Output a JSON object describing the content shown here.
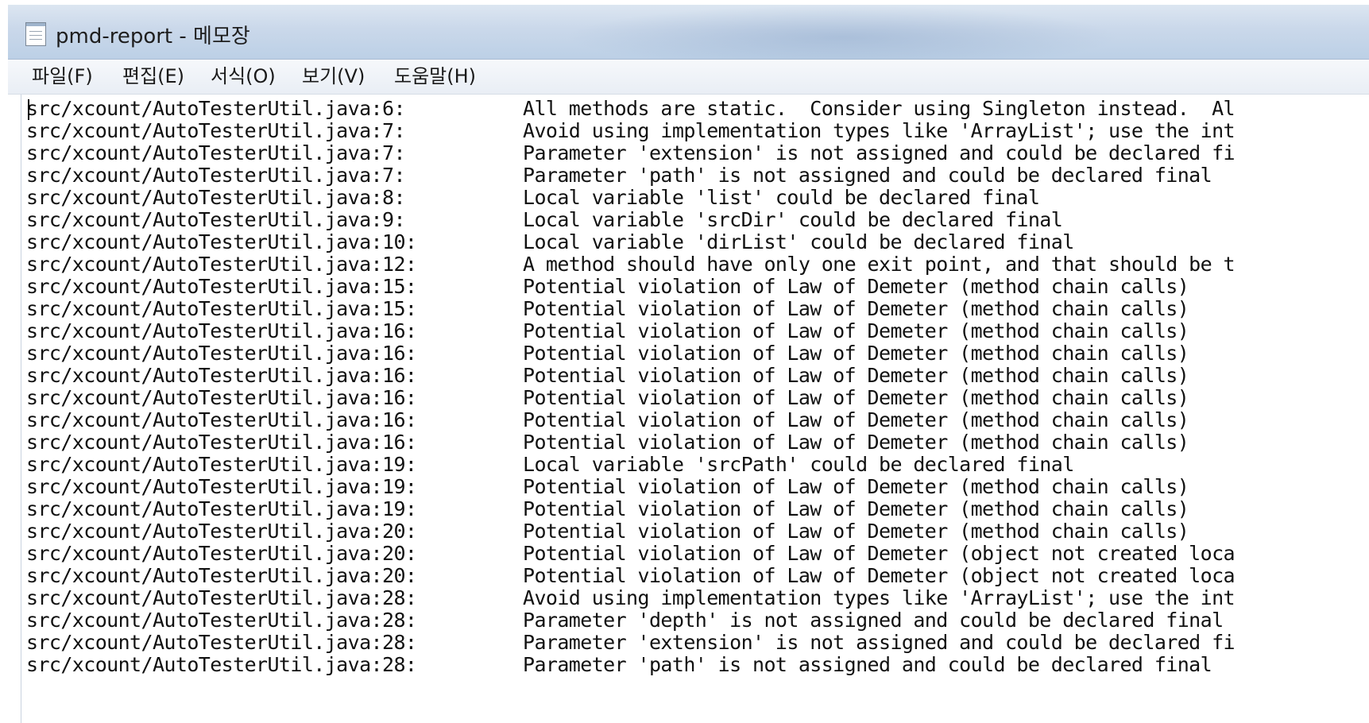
{
  "window": {
    "title": "pmd-report - 메모장"
  },
  "menu": [
    "파일(F)",
    "편집(E)",
    "서식(O)",
    "보기(V)",
    "도움말(H)"
  ],
  "lines": [
    {
      "path": "src/xcount/AutoTesterUtil.java:6:",
      "msg": "All methods are static.  Consider using Singleton instead.  Al"
    },
    {
      "path": "src/xcount/AutoTesterUtil.java:7:",
      "msg": "Avoid using implementation types like 'ArrayList'; use the int"
    },
    {
      "path": "src/xcount/AutoTesterUtil.java:7:",
      "msg": "Parameter 'extension' is not assigned and could be declared fi"
    },
    {
      "path": "src/xcount/AutoTesterUtil.java:7:",
      "msg": "Parameter 'path' is not assigned and could be declared final"
    },
    {
      "path": "src/xcount/AutoTesterUtil.java:8:",
      "msg": "Local variable 'list' could be declared final"
    },
    {
      "path": "src/xcount/AutoTesterUtil.java:9:",
      "msg": "Local variable 'srcDir' could be declared final"
    },
    {
      "path": "src/xcount/AutoTesterUtil.java:10:",
      "msg": "Local variable 'dirList' could be declared final"
    },
    {
      "path": "src/xcount/AutoTesterUtil.java:12:",
      "msg": "A method should have only one exit point, and that should be t"
    },
    {
      "path": "src/xcount/AutoTesterUtil.java:15:",
      "msg": "Potential violation of Law of Demeter (method chain calls)"
    },
    {
      "path": "src/xcount/AutoTesterUtil.java:15:",
      "msg": "Potential violation of Law of Demeter (method chain calls)"
    },
    {
      "path": "src/xcount/AutoTesterUtil.java:16:",
      "msg": "Potential violation of Law of Demeter (method chain calls)"
    },
    {
      "path": "src/xcount/AutoTesterUtil.java:16:",
      "msg": "Potential violation of Law of Demeter (method chain calls)"
    },
    {
      "path": "src/xcount/AutoTesterUtil.java:16:",
      "msg": "Potential violation of Law of Demeter (method chain calls)"
    },
    {
      "path": "src/xcount/AutoTesterUtil.java:16:",
      "msg": "Potential violation of Law of Demeter (method chain calls)"
    },
    {
      "path": "src/xcount/AutoTesterUtil.java:16:",
      "msg": "Potential violation of Law of Demeter (method chain calls)"
    },
    {
      "path": "src/xcount/AutoTesterUtil.java:16:",
      "msg": "Potential violation of Law of Demeter (method chain calls)"
    },
    {
      "path": "src/xcount/AutoTesterUtil.java:19:",
      "msg": "Local variable 'srcPath' could be declared final"
    },
    {
      "path": "src/xcount/AutoTesterUtil.java:19:",
      "msg": "Potential violation of Law of Demeter (method chain calls)"
    },
    {
      "path": "src/xcount/AutoTesterUtil.java:19:",
      "msg": "Potential violation of Law of Demeter (method chain calls)"
    },
    {
      "path": "src/xcount/AutoTesterUtil.java:20:",
      "msg": "Potential violation of Law of Demeter (method chain calls)"
    },
    {
      "path": "src/xcount/AutoTesterUtil.java:20:",
      "msg": "Potential violation of Law of Demeter (object not created loca"
    },
    {
      "path": "src/xcount/AutoTesterUtil.java:20:",
      "msg": "Potential violation of Law of Demeter (object not created loca"
    },
    {
      "path": "src/xcount/AutoTesterUtil.java:28:",
      "msg": "Avoid using implementation types like 'ArrayList'; use the int"
    },
    {
      "path": "src/xcount/AutoTesterUtil.java:28:",
      "msg": "Parameter 'depth' is not assigned and could be declared final"
    },
    {
      "path": "src/xcount/AutoTesterUtil.java:28:",
      "msg": "Parameter 'extension' is not assigned and could be declared fi"
    },
    {
      "path": "src/xcount/AutoTesterUtil.java:28:",
      "msg": "Parameter 'path' is not assigned and could be declared final"
    }
  ]
}
